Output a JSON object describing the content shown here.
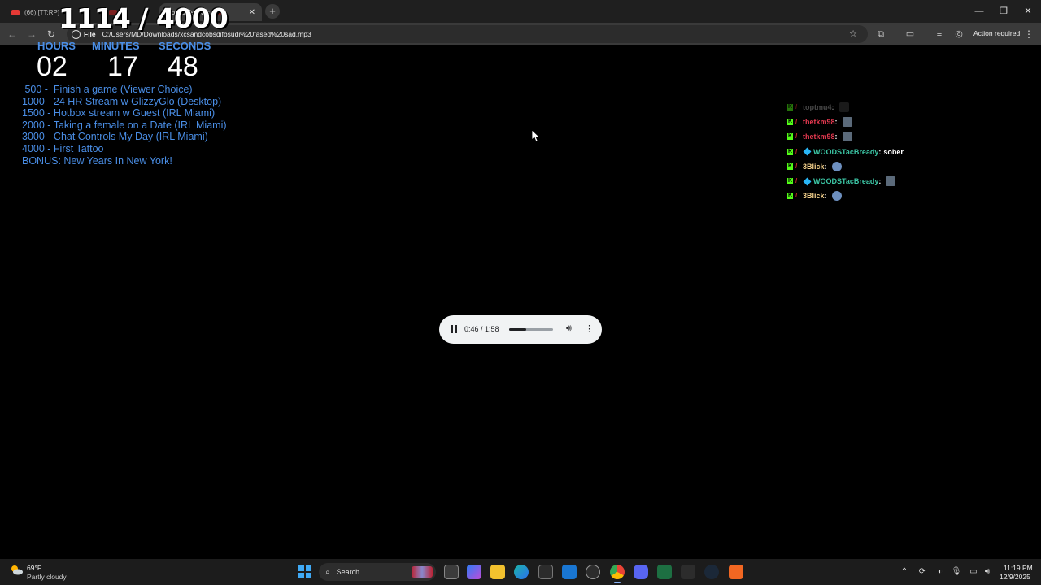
{
  "browser": {
    "tabs": [
      {
        "label": "(66) [TT:RP]",
        "active": false
      },
      {
        "label": "",
        "active": false
      },
      {
        "label": "dfbsudi fased s",
        "active": true
      }
    ],
    "new_tab": "+",
    "address": {
      "scheme": "File",
      "url": "C:/Users/MD/Downloads/xcsandcobsdifbsudi%20fased%20sad.mp3"
    },
    "action_required": "Action required"
  },
  "overlay": {
    "counter": "1114 / 4000",
    "timer": {
      "hours_label": "HOURS",
      "minutes_label": "MINUTES",
      "seconds_label": "SECONDS",
      "hours": "02",
      "minutes": "17",
      "seconds": "48"
    },
    "goals": [
      " 500 -  Finish a game (Viewer Choice)",
      "1000 - 24 HR Stream w GlizzyGlo (Desktop)",
      "1500 - Hotbox stream w Guest (IRL Miami)",
      "2000 - Taking a female on a Date (IRL Miami)",
      "3000 - Chat Controls My Day (IRL Miami)",
      "4000 - First Tattoo",
      "BONUS: New Years In New York!"
    ]
  },
  "chat": {
    "messages": [
      {
        "user": "toptmu4",
        "color": "#9e9e9e",
        "message": "",
        "diamond": false,
        "emote": "dark",
        "faded": true
      },
      {
        "user": "thetkm98",
        "color": "#e53950",
        "message": "",
        "diamond": false,
        "emote": "square",
        "faded": false
      },
      {
        "user": "thetkm98",
        "color": "#e53950",
        "message": "",
        "diamond": false,
        "emote": "square",
        "faded": false
      },
      {
        "user": "WOODSTacBready",
        "color": "#3cc7a6",
        "message": "sober",
        "diamond": true,
        "emote": "",
        "faded": false
      },
      {
        "user": "3Blick",
        "color": "#f2cf8a",
        "message": "",
        "diamond": false,
        "emote": "round",
        "faded": false
      },
      {
        "user": "WOODSTacBready",
        "color": "#3cc7a6",
        "message": "",
        "diamond": true,
        "emote": "square",
        "faded": false
      },
      {
        "user": "3Blick",
        "color": "#f2cf8a",
        "message": "",
        "diamond": false,
        "emote": "round",
        "faded": false
      }
    ]
  },
  "player": {
    "time": "0:46 / 1:58",
    "progress": 0.39
  },
  "taskbar": {
    "weather": {
      "temp": "69°F",
      "desc": "Partly cloudy"
    },
    "search_placeholder": "Search",
    "time": "11:19 PM",
    "date": "12/9/2025"
  },
  "colors": {
    "accent_blue": "#4a8ee6",
    "kick_green": "#53fc18"
  }
}
